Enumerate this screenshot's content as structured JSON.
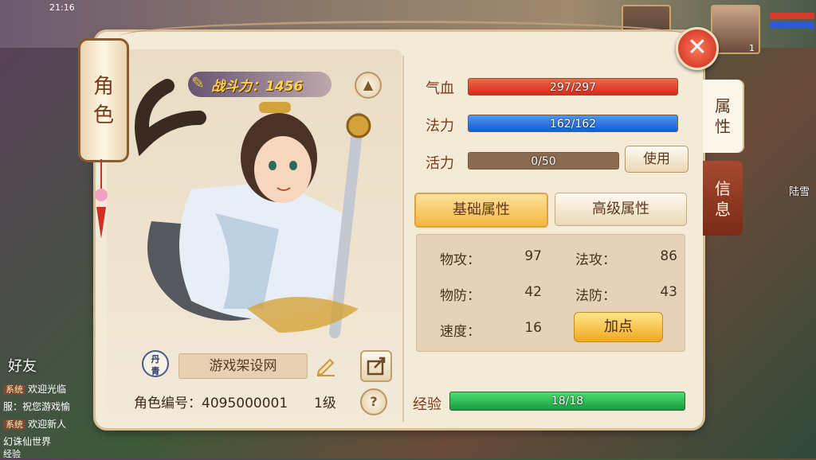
{
  "status_bar": {
    "time": "21:16"
  },
  "character_tab": {
    "label_line1": "角",
    "label_line2": "色"
  },
  "combat_power": {
    "label": "战斗力：1456"
  },
  "identity": {
    "emblem_line1": "丹",
    "emblem_line2": "青",
    "name": "游戏架设网",
    "id_label": "角色编号：",
    "id_value": "4095000001",
    "level": "1级",
    "help": "?"
  },
  "stats": {
    "hp": {
      "label": "气血",
      "value": "297/297",
      "fill": 1.0
    },
    "mp": {
      "label": "法力",
      "value": "162/162",
      "fill": 1.0
    },
    "vitality": {
      "label": "活力",
      "value": "0/50",
      "fill": 0.0
    },
    "use_button": "使用"
  },
  "attr_tabs": {
    "basic": "基础属性",
    "advanced": "高级属性"
  },
  "attributes": {
    "phys_atk": {
      "label": "物攻：",
      "value": "97"
    },
    "mag_atk": {
      "label": "法攻：",
      "value": "86"
    },
    "phys_def": {
      "label": "物防：",
      "value": "42"
    },
    "mag_def": {
      "label": "法防：",
      "value": "43"
    },
    "speed": {
      "label": "速度：",
      "value": "16"
    },
    "add_points": "加点"
  },
  "experience": {
    "label": "经验",
    "value": "18/18",
    "fill": 1.0
  },
  "side_tabs": {
    "attributes_l1": "属",
    "attributes_l2": "性",
    "info_l1": "信",
    "info_l2": "息"
  },
  "background": {
    "friends": "好友",
    "chat": [
      {
        "tag": "系统",
        "text": "欢迎光临"
      },
      {
        "tag": "",
        "text": "服：祝您游戏愉"
      },
      {
        "tag": "系统",
        "text": "欢迎新人"
      },
      {
        "tag": "",
        "text": "幻诛仙世界"
      }
    ],
    "player_name": "陆雪",
    "bottom_label": "经验",
    "avatar_level": "1"
  },
  "colors": {
    "hp": "#d62a18",
    "mp": "#1a5ad4",
    "exp": "#1a9a40",
    "accent": "#f4b640"
  }
}
